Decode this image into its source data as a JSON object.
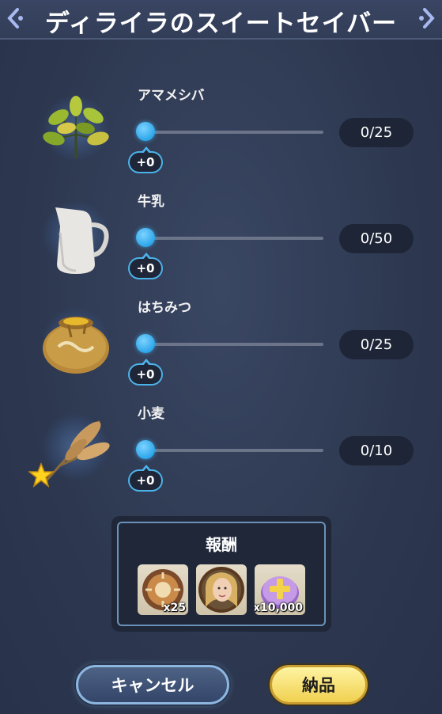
{
  "header": {
    "title": "ディライラのスイートセイバー"
  },
  "items": [
    {
      "name": "アマメシバ",
      "icon": "leafy-plant-icon",
      "delta": "+0",
      "count": "0/25",
      "progress": 0
    },
    {
      "name": "牛乳",
      "icon": "milk-pitcher-icon",
      "delta": "+0",
      "count": "0/50",
      "progress": 0
    },
    {
      "name": "はちみつ",
      "icon": "honey-pot-icon",
      "delta": "+0",
      "count": "0/25",
      "progress": 0
    },
    {
      "name": "小麦",
      "icon": "wheat-icon",
      "delta": "+0",
      "count": "0/10",
      "progress": 0,
      "starred": true
    }
  ],
  "rewards": {
    "title": "報酬",
    "tiles": [
      {
        "icon": "sun-medallion-icon",
        "qty": "x25"
      },
      {
        "icon": "character-portrait-icon",
        "qty": ""
      },
      {
        "icon": "purple-coin-icon",
        "qty": "x10,000"
      }
    ]
  },
  "buttons": {
    "cancel": "キャンセル",
    "submit": "納品"
  },
  "colors": {
    "accent": "#46b6f0",
    "submit": "#f0d050",
    "background": "#2f3a52"
  }
}
